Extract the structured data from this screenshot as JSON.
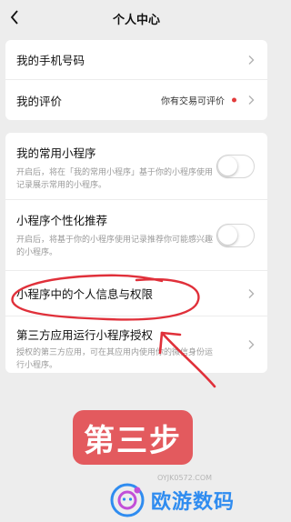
{
  "header": {
    "title": "个人中心"
  },
  "card1": {
    "phone_label": "我的手机号码",
    "rating_label": "我的评价",
    "rating_hint": "你有交易可评价"
  },
  "card2": {
    "mini_title": "我的常用小程序",
    "mini_desc": "开启后，将在「我的常用小程序」基于你的小程序使用记录展示常用的小程序。",
    "personal_title": "小程序个性化推荐",
    "personal_desc": "开启后，将基于你的小程序使用记录推荐你可能感兴趣的小程序。",
    "privacy_label": "小程序中的个人信息与权限",
    "third_title": "第三方应用运行小程序授权",
    "third_desc": "授权的第三方应用，可在其应用内使用你的微信身份运行小程序。"
  },
  "annotation": {
    "step": "第三步"
  },
  "watermark": {
    "url": "OYJK0572.COM",
    "brand": "欧游数码"
  },
  "colors": {
    "background": "#ededed",
    "card": "#ffffff",
    "annotation_red": "#e0303a",
    "step_badge": "#e35a5e",
    "brand_blue": "#2f8cf0"
  },
  "toggles": {
    "mini_enabled": false,
    "personal_enabled": false
  }
}
